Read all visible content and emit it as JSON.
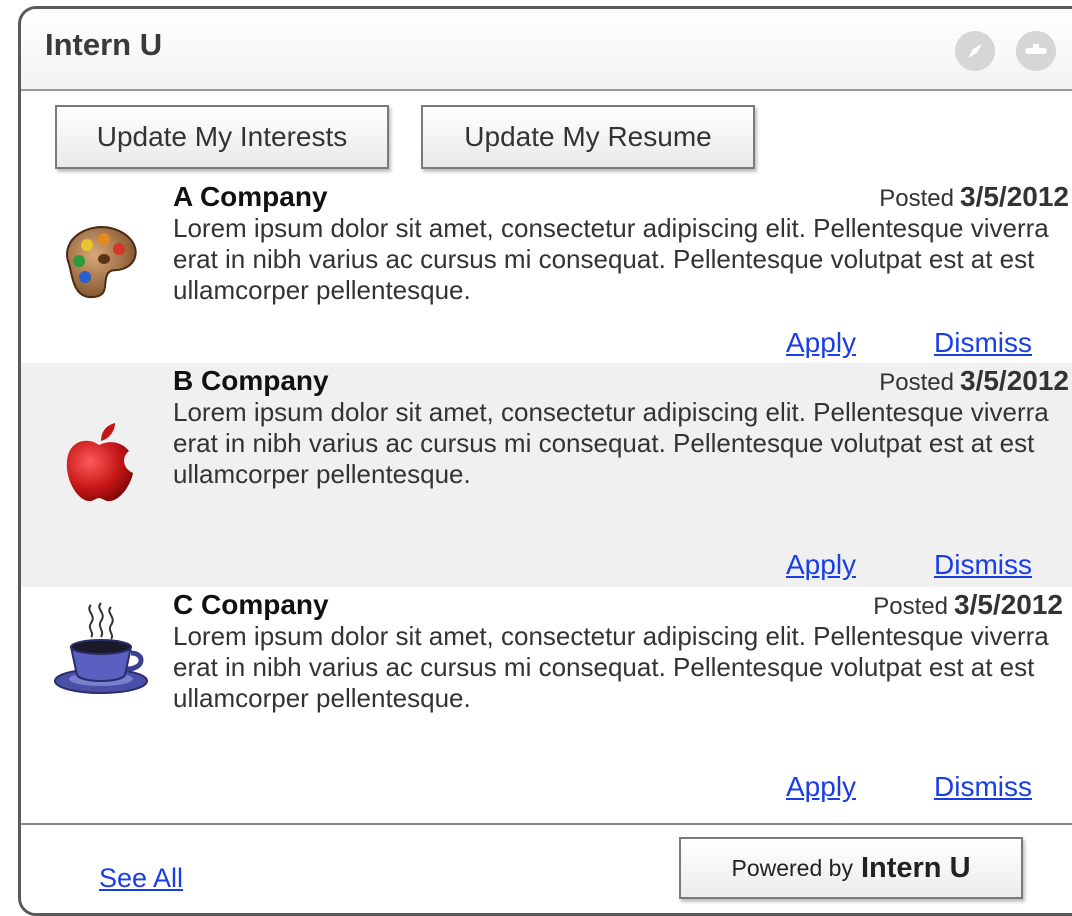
{
  "app": {
    "title": "Intern U"
  },
  "toolbar": {
    "update_interests_label": "Update My Interests",
    "update_resume_label": "Update My Resume"
  },
  "jobs": [
    {
      "company": "A Company",
      "posted_label": "Posted",
      "posted_date": "3/5/2012",
      "description": "Lorem ipsum dolor sit amet, consectetur adipiscing elit. Pellentesque viverra erat in nibh varius ac cursus mi consequat. Pellentesque volutpat est at est ullamcorper pellentesque.",
      "icon": "paint-palette-icon",
      "apply_label": "Apply",
      "dismiss_label": "Dismiss"
    },
    {
      "company": "B Company",
      "posted_label": "Posted",
      "posted_date": "3/5/2012",
      "description": "Lorem ipsum dolor sit amet, consectetur adipiscing elit. Pellentesque viverra erat in nibh varius ac cursus mi consequat. Pellentesque volutpat est at est ullamcorper pellentesque.",
      "icon": "apple-icon",
      "apply_label": "Apply",
      "dismiss_label": "Dismiss"
    },
    {
      "company": "C Company",
      "posted_label": "Posted",
      "posted_date": "3/5/2012",
      "description": "Lorem ipsum dolor sit amet, consectetur adipiscing elit. Pellentesque viverra erat in nibh varius ac cursus mi consequat. Pellentesque volutpat est at est ullamcorper pellentesque.",
      "icon": "coffee-cup-icon",
      "apply_label": "Apply",
      "dismiss_label": "Dismiss"
    }
  ],
  "footer": {
    "see_all_label": "See All",
    "powered_by_label": "Powered by",
    "powered_by_brand": "Intern U"
  },
  "colors": {
    "link": "#1a3ee6",
    "shaded_row": "#f0f0f0",
    "border": "#5a5a5a"
  }
}
